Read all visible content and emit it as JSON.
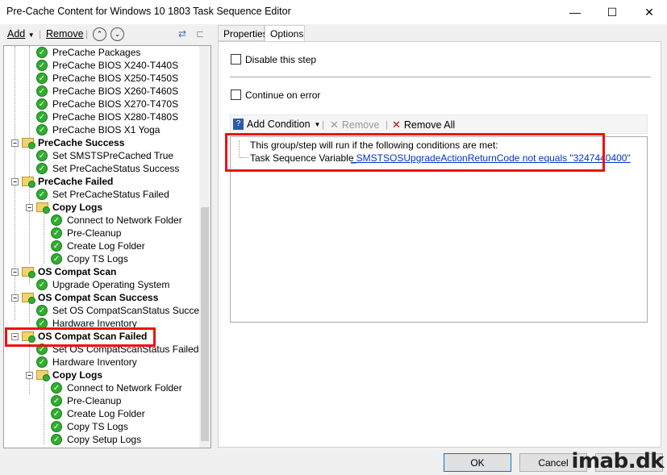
{
  "window": {
    "title": "Pre-Cache Content for Windows 10 1803 Task Sequence Editor",
    "minimize_glyph": "—",
    "maximize_glyph": "☐",
    "close_glyph": "✕"
  },
  "toolbar": {
    "add_label": "Add",
    "remove_label": "Remove",
    "up_glyph": "⌃",
    "down_glyph": "⌄"
  },
  "tree": {
    "items": [
      {
        "label": "PreCache Packages",
        "kind": "step"
      },
      {
        "label": "PreCache BIOS X240-T440S",
        "kind": "step"
      },
      {
        "label": "PreCache BIOS X250-T450S",
        "kind": "step"
      },
      {
        "label": "PreCache BIOS X260-T460S",
        "kind": "step"
      },
      {
        "label": "PreCache BIOS X270-T470S",
        "kind": "step"
      },
      {
        "label": "PreCache BIOS X280-T480S",
        "kind": "step"
      },
      {
        "label": "PreCache BIOS X1 Yoga",
        "kind": "step"
      },
      {
        "label": "PreCache Success",
        "kind": "group"
      },
      {
        "label": "Set SMSTSPreCached True",
        "kind": "step"
      },
      {
        "label": "Set PreCacheStatus Success",
        "kind": "step"
      },
      {
        "label": "PreCache Failed",
        "kind": "group"
      },
      {
        "label": "Set PreCacheStatus Failed",
        "kind": "step"
      },
      {
        "label": "Copy Logs",
        "kind": "group"
      },
      {
        "label": "Connect to Network Folder",
        "kind": "step"
      },
      {
        "label": "Pre-Cleanup",
        "kind": "step"
      },
      {
        "label": "Create Log Folder",
        "kind": "step"
      },
      {
        "label": "Copy TS Logs",
        "kind": "step"
      },
      {
        "label": "OS Compat Scan",
        "kind": "group"
      },
      {
        "label": "Upgrade Operating System",
        "kind": "step"
      },
      {
        "label": "OS Compat Scan Success",
        "kind": "group"
      },
      {
        "label": "Set OS CompatScanStatus Success",
        "kind": "step"
      },
      {
        "label": "Hardware Inventory",
        "kind": "step"
      },
      {
        "label": "OS Compat Scan Failed",
        "kind": "group"
      },
      {
        "label": "Set OS CompatScanStatus Failed",
        "kind": "step"
      },
      {
        "label": "Hardware Inventory",
        "kind": "step"
      },
      {
        "label": "Copy Logs",
        "kind": "group"
      },
      {
        "label": "Connect to Network Folder",
        "kind": "step"
      },
      {
        "label": "Pre-Cleanup",
        "kind": "step"
      },
      {
        "label": "Create Log Folder",
        "kind": "step"
      },
      {
        "label": "Copy TS Logs",
        "kind": "step"
      },
      {
        "label": "Copy Setup Logs",
        "kind": "step"
      }
    ]
  },
  "tabs": {
    "properties": "Properties",
    "options": "Options"
  },
  "options": {
    "disable_step": "Disable this step",
    "continue_on_error": "Continue on error",
    "add_condition": "Add Condition",
    "remove": "Remove",
    "remove_all": "Remove All",
    "conditions_header": "This group/step will run if the following conditions are met:",
    "condition_type": "Task Sequence Variable",
    "condition_value": "_SMSTSOSUpgradeActionReturnCode not equals \"3247440400\""
  },
  "buttons": {
    "ok": "OK",
    "cancel": "Cancel"
  },
  "watermark": "imab.dk",
  "colors": {
    "highlight": "#ee1111",
    "link": "#0033cc",
    "check_green": "#2fae2f"
  }
}
